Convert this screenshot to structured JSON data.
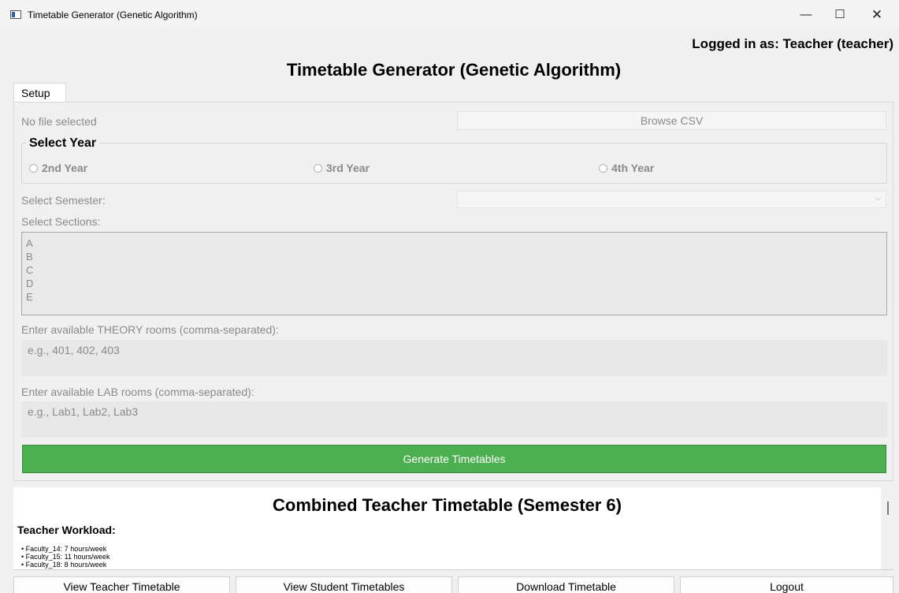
{
  "window": {
    "title": "Timetable Generator (Genetic Algorithm)",
    "minimize_glyph": "—",
    "maximize_glyph": "☐",
    "close_glyph": "✕"
  },
  "header": {
    "logged_in": "Logged in as: Teacher (teacher)",
    "title": "Timetable Generator (Genetic Algorithm)"
  },
  "tabs": [
    {
      "label": "Setup"
    }
  ],
  "setup": {
    "file_status": "No file selected",
    "browse_label": "Browse CSV",
    "year_group_label": "Select Year",
    "years": [
      {
        "label": "2nd Year"
      },
      {
        "label": "3rd Year"
      },
      {
        "label": "4th Year"
      }
    ],
    "semester_label": "Select Semester:",
    "semester_value": "",
    "sections_label": "Select Sections:",
    "sections": [
      "A",
      "B",
      "C",
      "D",
      "E"
    ],
    "theory_label": "Enter available THEORY rooms (comma-separated):",
    "theory_placeholder": "e.g., 401, 402, 403",
    "lab_label": "Enter available LAB rooms (comma-separated):",
    "lab_placeholder": "e.g., Lab1, Lab2, Lab3",
    "generate_label": "Generate Timetables"
  },
  "output": {
    "title": "Combined Teacher Timetable (Semester 6)",
    "workload_heading": "Teacher Workload:",
    "workload": [
      "Faculty_14: 7 hours/week",
      "Faculty_15: 11 hours/week",
      "Faculty_18: 8 hours/week"
    ]
  },
  "footer": {
    "view_teacher": "View Teacher Timetable",
    "view_student": "View Student Timetables",
    "download": "Download Timetable",
    "logout": "Logout"
  },
  "colors": {
    "generate_button": "#4caf50",
    "disabled_text": "#8a8a8a",
    "background": "#f0f0f0"
  }
}
